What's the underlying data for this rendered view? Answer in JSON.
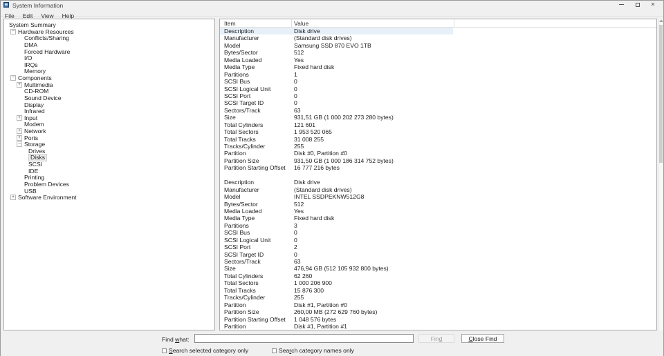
{
  "window": {
    "title": "System Information",
    "icon": "system-information-app-icon",
    "controls": {
      "minimize": "minimize-icon",
      "maximize": "maximize-icon",
      "close": "✕"
    }
  },
  "menu": {
    "items": [
      "File",
      "Edit",
      "View",
      "Help"
    ]
  },
  "tree": {
    "items": [
      {
        "label": "System Summary",
        "level": 0,
        "glyph": null,
        "selected": false
      },
      {
        "label": "Hardware Resources",
        "level": 1,
        "glyph": "minus",
        "selected": false
      },
      {
        "label": "Conflicts/Sharing",
        "level": 2,
        "glyph": null,
        "selected": false
      },
      {
        "label": "DMA",
        "level": 2,
        "glyph": null,
        "selected": false
      },
      {
        "label": "Forced Hardware",
        "level": 2,
        "glyph": null,
        "selected": false
      },
      {
        "label": "I/O",
        "level": 2,
        "glyph": null,
        "selected": false
      },
      {
        "label": "IRQs",
        "level": 2,
        "glyph": null,
        "selected": false
      },
      {
        "label": "Memory",
        "level": 2,
        "glyph": null,
        "selected": false
      },
      {
        "label": "Components",
        "level": 1,
        "glyph": "minus",
        "selected": false
      },
      {
        "label": "Multimedia",
        "level": 2,
        "glyph": "plus",
        "selected": false
      },
      {
        "label": "CD-ROM",
        "level": 2,
        "glyph": null,
        "selected": false
      },
      {
        "label": "Sound Device",
        "level": 2,
        "glyph": null,
        "selected": false
      },
      {
        "label": "Display",
        "level": 2,
        "glyph": null,
        "selected": false
      },
      {
        "label": "Infrared",
        "level": 2,
        "glyph": null,
        "selected": false
      },
      {
        "label": "Input",
        "level": 2,
        "glyph": "plus",
        "selected": false
      },
      {
        "label": "Modem",
        "level": 2,
        "glyph": null,
        "selected": false
      },
      {
        "label": "Network",
        "level": 2,
        "glyph": "plus",
        "selected": false
      },
      {
        "label": "Ports",
        "level": 2,
        "glyph": "plus",
        "selected": false
      },
      {
        "label": "Storage",
        "level": 2,
        "glyph": "minus",
        "selected": false
      },
      {
        "label": "Drives",
        "level": 3,
        "glyph": null,
        "selected": false
      },
      {
        "label": "Disks",
        "level": 3,
        "glyph": null,
        "selected": true
      },
      {
        "label": "SCSI",
        "level": 3,
        "glyph": null,
        "selected": false
      },
      {
        "label": "IDE",
        "level": 3,
        "glyph": null,
        "selected": false
      },
      {
        "label": "Printing",
        "level": 2,
        "glyph": null,
        "selected": false
      },
      {
        "label": "Problem Devices",
        "level": 2,
        "glyph": null,
        "selected": false
      },
      {
        "label": "USB",
        "level": 2,
        "glyph": null,
        "selected": false
      },
      {
        "label": "Software Environment",
        "level": 1,
        "glyph": "plus",
        "selected": false
      }
    ]
  },
  "list": {
    "columns": {
      "item": "Item",
      "value": "Value"
    },
    "rows": [
      {
        "item": "Description",
        "value": "Disk drive",
        "selected": true
      },
      {
        "item": "Manufacturer",
        "value": "(Standard disk drives)"
      },
      {
        "item": "Model",
        "value": "Samsung SSD 870 EVO 1TB"
      },
      {
        "item": "Bytes/Sector",
        "value": "512"
      },
      {
        "item": "Media Loaded",
        "value": "Yes"
      },
      {
        "item": "Media Type",
        "value": "Fixed hard disk"
      },
      {
        "item": "Partitions",
        "value": "1"
      },
      {
        "item": "SCSI Bus",
        "value": "0"
      },
      {
        "item": "SCSI Logical Unit",
        "value": "0"
      },
      {
        "item": "SCSI Port",
        "value": "0"
      },
      {
        "item": "SCSI Target ID",
        "value": "0"
      },
      {
        "item": "Sectors/Track",
        "value": "63"
      },
      {
        "item": "Size",
        "value": "931,51 GB (1 000 202 273 280 bytes)"
      },
      {
        "item": "Total Cylinders",
        "value": "121 601"
      },
      {
        "item": "Total Sectors",
        "value": "1 953 520 065"
      },
      {
        "item": "Total Tracks",
        "value": "31 008 255"
      },
      {
        "item": "Tracks/Cylinder",
        "value": "255"
      },
      {
        "item": "Partition",
        "value": "Disk #0, Partition #0"
      },
      {
        "item": "Partition Size",
        "value": "931,50 GB (1 000 186 314 752 bytes)"
      },
      {
        "item": "Partition Starting Offset",
        "value": "16 777 216 bytes"
      },
      {
        "blank": true
      },
      {
        "item": "Description",
        "value": "Disk drive"
      },
      {
        "item": "Manufacturer",
        "value": "(Standard disk drives)"
      },
      {
        "item": "Model",
        "value": "INTEL SSDPEKNW512G8"
      },
      {
        "item": "Bytes/Sector",
        "value": "512"
      },
      {
        "item": "Media Loaded",
        "value": "Yes"
      },
      {
        "item": "Media Type",
        "value": "Fixed hard disk"
      },
      {
        "item": "Partitions",
        "value": "3"
      },
      {
        "item": "SCSI Bus",
        "value": "0"
      },
      {
        "item": "SCSI Logical Unit",
        "value": "0"
      },
      {
        "item": "SCSI Port",
        "value": "2"
      },
      {
        "item": "SCSI Target ID",
        "value": "0"
      },
      {
        "item": "Sectors/Track",
        "value": "63"
      },
      {
        "item": "Size",
        "value": "476,94 GB (512 105 932 800 bytes)"
      },
      {
        "item": "Total Cylinders",
        "value": "62 260"
      },
      {
        "item": "Total Sectors",
        "value": "1 000 206 900"
      },
      {
        "item": "Total Tracks",
        "value": "15 876 300"
      },
      {
        "item": "Tracks/Cylinder",
        "value": "255"
      },
      {
        "item": "Partition",
        "value": "Disk #1, Partition #0"
      },
      {
        "item": "Partition Size",
        "value": "260,00 MB (272 629 760 bytes)"
      },
      {
        "item": "Partition Starting Offset",
        "value": "1 048 576 bytes"
      },
      {
        "item": "Partition",
        "value": "Disk #1, Partition #1"
      }
    ]
  },
  "findbar": {
    "label": {
      "pre": "Find ",
      "accel": "w",
      "post": "hat:"
    },
    "input_value": "",
    "find_button": {
      "pre": "Fin",
      "accel": "d",
      "post": ""
    },
    "close_button": {
      "pre": "",
      "accel": "C",
      "post": "lose Find"
    },
    "checkbox_selected_category": {
      "pre": "",
      "accel": "S",
      "post": "earch selected category only",
      "checked": false
    },
    "checkbox_category_names": {
      "pre": "Sea",
      "accel": "r",
      "post": "ch category names only",
      "checked": false
    }
  },
  "colors": {
    "selection_row": "#e7f0f9",
    "pane_border": "#acacac",
    "window_bg": "#f0f0f0",
    "app_icon_blue": "#3a6ea5"
  }
}
